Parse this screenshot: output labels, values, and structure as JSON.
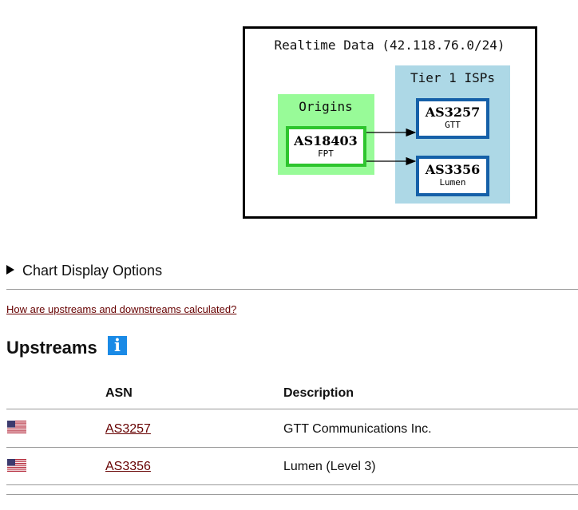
{
  "graph": {
    "title": "Realtime Data (42.118.76.0/24)",
    "origins_label": "Origins",
    "tier1_label": "Tier 1 ISPs",
    "origin_node": {
      "asn": "AS18403",
      "name": "FPT"
    },
    "tier1_nodes": [
      {
        "asn": "AS3257",
        "name": "GTT"
      },
      {
        "asn": "AS3356",
        "name": "Lumen"
      }
    ],
    "colors": {
      "origins_bg": "#98fb98",
      "origin_border": "#2ec52e",
      "tier1_bg": "#add8e6",
      "tier1_border": "#1560a8"
    }
  },
  "chart_options_label": "Chart Display Options",
  "calc_link": "How are upstreams and downstreams calculated?",
  "upstreams": {
    "heading": "Upstreams",
    "info_icon": "i",
    "columns": {
      "asn": "ASN",
      "description": "Description"
    },
    "rows": [
      {
        "flag": "us-flag-icon",
        "asn": "AS3257",
        "description": "GTT Communications Inc."
      },
      {
        "flag": "us-flag-icon",
        "asn": "AS3356",
        "description": "Lumen (Level 3)"
      }
    ]
  }
}
